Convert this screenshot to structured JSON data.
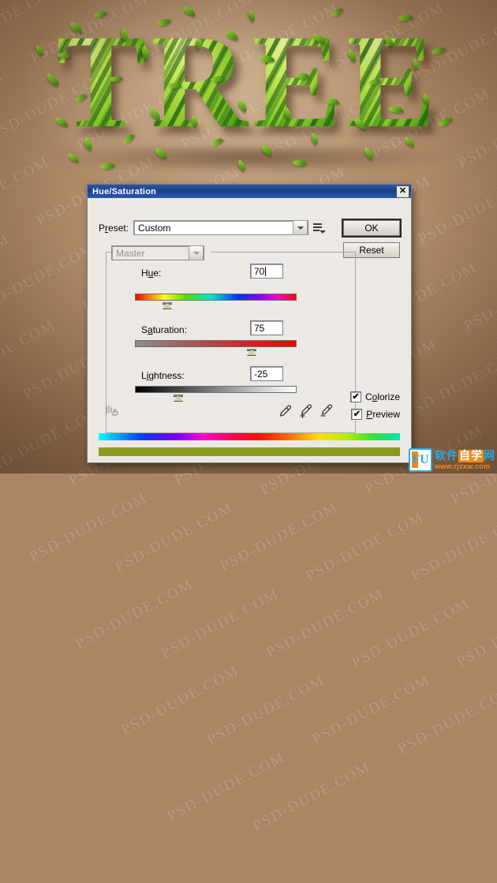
{
  "artwork": {
    "headline": "TREE",
    "letters": [
      "T",
      "R",
      "E",
      "E"
    ],
    "background_color": "#ab8564",
    "leaf_color": "#6cb021",
    "watermark_text": "PSD-DUDE.COM"
  },
  "dialog": {
    "title": "Hue/Saturation",
    "close_label": "✕",
    "preset": {
      "label": "Preset:",
      "label_prefix": "P",
      "label_accel": "r",
      "label_suffix": "eset:",
      "value": "Custom",
      "menu_icon": "preset-options-icon"
    },
    "buttons": {
      "ok": "OK",
      "reset": "Reset"
    },
    "channel": {
      "value": "Master",
      "disabled": true
    },
    "sliders": [
      {
        "id": "hue",
        "label_prefix": "H",
        "label_accel": "u",
        "label_suffix": "e:",
        "label": "Hue:",
        "value": "70",
        "thumb_percent": 20,
        "has_caret": true,
        "range": [
          -180,
          180
        ]
      },
      {
        "id": "saturation",
        "label_prefix": "S",
        "label_accel": "a",
        "label_suffix": "turation:",
        "label": "Saturation:",
        "value": "75",
        "thumb_percent": 72,
        "has_caret": false,
        "range": [
          0,
          100
        ]
      },
      {
        "id": "lightness",
        "label_prefix": "L",
        "label_accel": "i",
        "label_suffix": "ghtness:",
        "label": "Lightness:",
        "value": "-25",
        "thumb_percent": 27,
        "has_caret": false,
        "range": [
          -100,
          100
        ]
      }
    ],
    "tools": {
      "scrubby": "on-image-adjustment-tool",
      "eyedroppers": [
        "eyedropper-icon",
        "eyedropper-plus-icon",
        "eyedropper-minus-icon"
      ]
    },
    "checkboxes": [
      {
        "id": "colorize",
        "label": "Colorize",
        "label_prefix": "C",
        "label_accel": "o",
        "label_suffix": "lorize",
        "checked": true,
        "mark": "✔"
      },
      {
        "id": "preview",
        "label": "Preview",
        "label_prefix": "",
        "label_accel": "P",
        "label_suffix": "review",
        "checked": true,
        "mark": "✔"
      }
    ],
    "color_bars": {
      "input_bar": "full-spectrum",
      "output_bar": "#8c9b1e"
    }
  },
  "site_logo": {
    "mark": "FU",
    "cn_part1": "软件",
    "cn_part2": "自学",
    "cn_part3": "网",
    "url": "www.rjzxw.com"
  }
}
